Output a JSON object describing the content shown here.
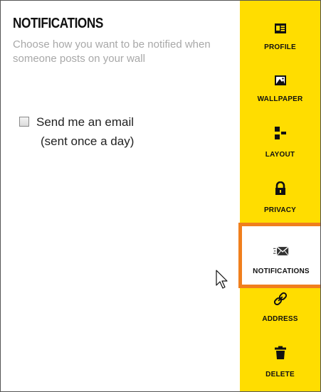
{
  "section": {
    "title": "NOTIFICATIONS",
    "description": "Choose how you want to be notified when someone posts on your wall"
  },
  "option": {
    "label": "Send me an email",
    "sublabel": "(sent once a day)",
    "checked": false
  },
  "sidebar": {
    "background": "#ffdd00",
    "active_border": "#f07f1d",
    "items": [
      {
        "label": "PROFILE",
        "icon": "profile-card-icon"
      },
      {
        "label": "WALLPAPER",
        "icon": "image-icon"
      },
      {
        "label": "LAYOUT",
        "icon": "layout-icon"
      },
      {
        "label": "PRIVACY",
        "icon": "lock-icon"
      },
      {
        "label": "NOTIFICATIONS",
        "icon": "envelope-icon",
        "active": true
      },
      {
        "label": "ADDRESS",
        "icon": "link-icon"
      },
      {
        "label": "DELETE",
        "icon": "trash-icon"
      }
    ]
  }
}
